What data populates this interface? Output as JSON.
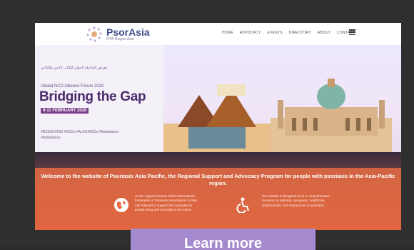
{
  "nav": {
    "logo_name": "PsorAsia",
    "logo_sub": "IFPA Region Asia",
    "items": [
      "HOME",
      "ADVOCACY",
      "EVENTS",
      "DIRECTORY",
      "ABOUT",
      "CONTACT"
    ]
  },
  "hero": {
    "arabic_line": "معرض الشارقة الدولي للكتاب الثامن والثلاثين",
    "forum_label": "Global NCD Alliance Forum 2020",
    "headline": "Bridging the Gap",
    "dates": "9-11 FEBRUARY 2020",
    "hashtags": "#NCDAF2020 #NCDs #ActOnNCDs #Ambulance #Ambulance"
  },
  "welcome": {
    "text": "Welcome to the website of Psoriasis Asia Pacific, the Regional Support and Advocacy Program for people with psoriasis in the Asia-Pacific region."
  },
  "columns": {
    "left": "As the regional branch of the International Federation of Psoriasis Associations in their role relevant to support and advocate for people living with psoriasis in the region.",
    "right": "Our website is designed to be a comprehensive resource for patients, caregivers, healthcare professionals, and researchers on psoriasis."
  },
  "cta": {
    "label": "Learn more"
  },
  "colors": {
    "cta_bg": "#a68ad0",
    "overlay": "#ec6c44",
    "brand": "#3e4a8a"
  }
}
